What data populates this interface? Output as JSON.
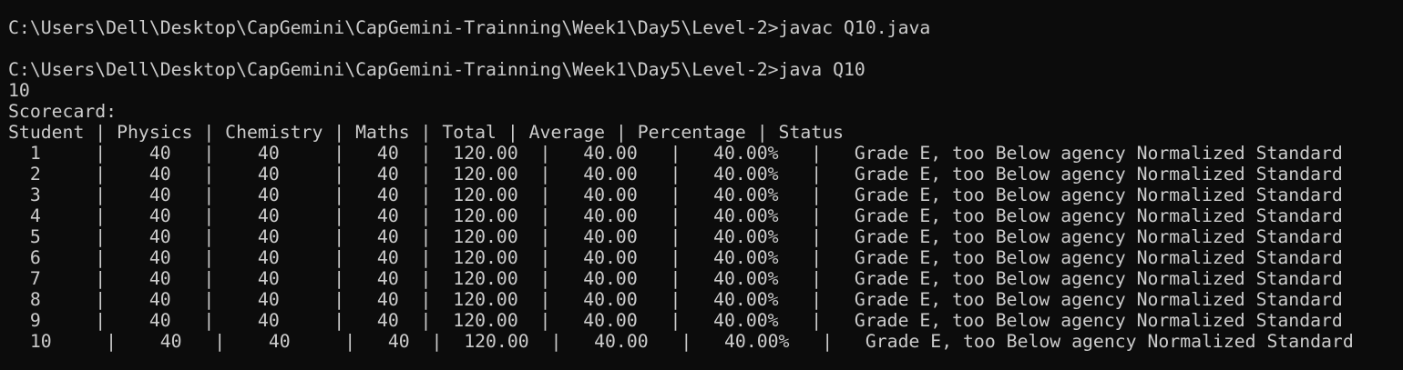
{
  "terminal": {
    "lines": [
      "C:\\Users\\Dell\\Desktop\\CapGemini\\CapGemini-Trainning\\Week1\\Day5\\Level-2>javac Q10.java",
      "",
      "C:\\Users\\Dell\\Desktop\\CapGemini\\CapGemini-Trainning\\Week1\\Day5\\Level-2>java Q10",
      "10",
      "Scorecard:",
      "Student | Physics | Chemistry | Maths | Total | Average | Percentage | Status",
      "  1     |    40   |    40     |   40  |  120.00  |   40.00   |   40.00%   |   Grade E, too Below agency Normalized Standard",
      "  2     |    40   |    40     |   40  |  120.00  |   40.00   |   40.00%   |   Grade E, too Below agency Normalized Standard",
      "  3     |    40   |    40     |   40  |  120.00  |   40.00   |   40.00%   |   Grade E, too Below agency Normalized Standard",
      "  4     |    40   |    40     |   40  |  120.00  |   40.00   |   40.00%   |   Grade E, too Below agency Normalized Standard",
      "  5     |    40   |    40     |   40  |  120.00  |   40.00   |   40.00%   |   Grade E, too Below agency Normalized Standard",
      "  6     |    40   |    40     |   40  |  120.00  |   40.00   |   40.00%   |   Grade E, too Below agency Normalized Standard",
      "  7     |    40   |    40     |   40  |  120.00  |   40.00   |   40.00%   |   Grade E, too Below agency Normalized Standard",
      "  8     |    40   |    40     |   40  |  120.00  |   40.00   |   40.00%   |   Grade E, too Below agency Normalized Standard",
      "  9     |    40   |    40     |   40  |  120.00  |   40.00   |   40.00%   |   Grade E, too Below agency Normalized Standard",
      "  10     |    40   |    40     |   40  |  120.00  |   40.00   |   40.00%   |   Grade E, too Below agency Normalized Standard"
    ]
  },
  "colors": {
    "background": "#0c0c0c",
    "foreground": "#cccccc"
  }
}
